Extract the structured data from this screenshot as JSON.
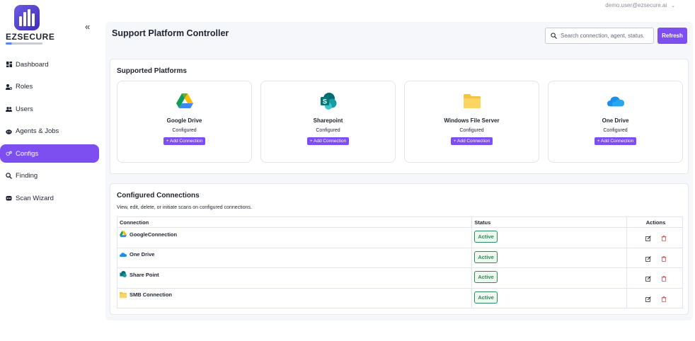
{
  "header": {
    "user_email": "demo.user@ezsecure.ai"
  },
  "brand": {
    "name": "EZSECURE"
  },
  "sidebar": {
    "items": [
      {
        "label": "Dashboard",
        "icon": "dashboard-icon",
        "active": false
      },
      {
        "label": "Roles",
        "icon": "user-cog-icon",
        "active": false
      },
      {
        "label": "Users",
        "icon": "users-icon",
        "active": false
      },
      {
        "label": "Agents & Jobs",
        "icon": "agent-icon",
        "active": false
      },
      {
        "label": "Configs",
        "icon": "gear-icon",
        "active": true
      },
      {
        "label": "Finding",
        "icon": "search-icon",
        "active": false
      },
      {
        "label": "Scan Wizard",
        "icon": "wizard-icon",
        "active": false
      }
    ]
  },
  "page": {
    "title": "Support Platform Controller",
    "search_placeholder": "Search connection, agent, status.",
    "refresh_label": "Refresh"
  },
  "platforms": {
    "title": "Supported Platforms",
    "items": [
      {
        "name": "Google Drive",
        "status": "Configured",
        "add_label": "+ Add Connection",
        "icon": "google-drive-icon"
      },
      {
        "name": "Sharepoint",
        "status": "Configured",
        "add_label": "+ Add Connection",
        "icon": "sharepoint-icon"
      },
      {
        "name": "Windows File Server",
        "status": "Configured",
        "add_label": "+ Add Connection",
        "icon": "folder-icon"
      },
      {
        "name": "One Drive",
        "status": "Configured",
        "add_label": "+ Add Connection",
        "icon": "onedrive-icon"
      }
    ]
  },
  "connections": {
    "title": "Configured Connections",
    "description": "View, edit, delete, or initiate scans on configured connections.",
    "columns": [
      "Connection",
      "Status",
      "Actions"
    ],
    "rows": [
      {
        "name": "GoogleConnection",
        "status": "Active",
        "icon": "google-drive-icon"
      },
      {
        "name": "One Drive",
        "status": "Active",
        "icon": "onedrive-icon"
      },
      {
        "name": "Share Point",
        "status": "Active",
        "icon": "sharepoint-icon"
      },
      {
        "name": "SMB Connection",
        "status": "Active",
        "icon": "folder-icon"
      }
    ]
  },
  "colors": {
    "accent": "#7d4ff0",
    "active_status": "#2e8b57",
    "panel_bg": "#f5f7fb"
  }
}
